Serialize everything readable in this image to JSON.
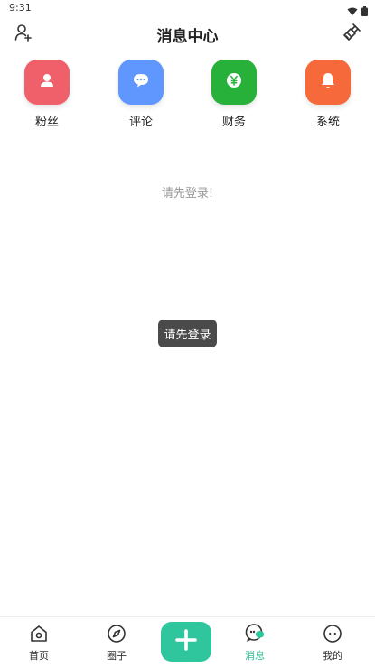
{
  "status": {
    "time": "9:31"
  },
  "header": {
    "title": "消息中心",
    "left_icon": "add-user-icon",
    "right_icon": "broom-icon"
  },
  "categories": [
    {
      "label": "粉丝",
      "icon": "person-icon",
      "color": "#f0606a"
    },
    {
      "label": "评论",
      "icon": "chat-bubble-icon",
      "color": "#5f97ff"
    },
    {
      "label": "财务",
      "icon": "yen-coin-icon",
      "color": "#27b03a"
    },
    {
      "label": "系统",
      "icon": "bell-icon",
      "color": "#f5693b"
    }
  ],
  "empty_message": "请先登录!",
  "toast": "请先登录",
  "tabbar": {
    "items": [
      {
        "label": "首页",
        "icon": "home-icon"
      },
      {
        "label": "圈子",
        "icon": "compass-icon"
      },
      {
        "label": "",
        "icon": "plus-icon"
      },
      {
        "label": "消息",
        "icon": "message-icon",
        "active": true
      },
      {
        "label": "我的",
        "icon": "profile-face-icon"
      }
    ],
    "accent": "#2fc59d"
  }
}
